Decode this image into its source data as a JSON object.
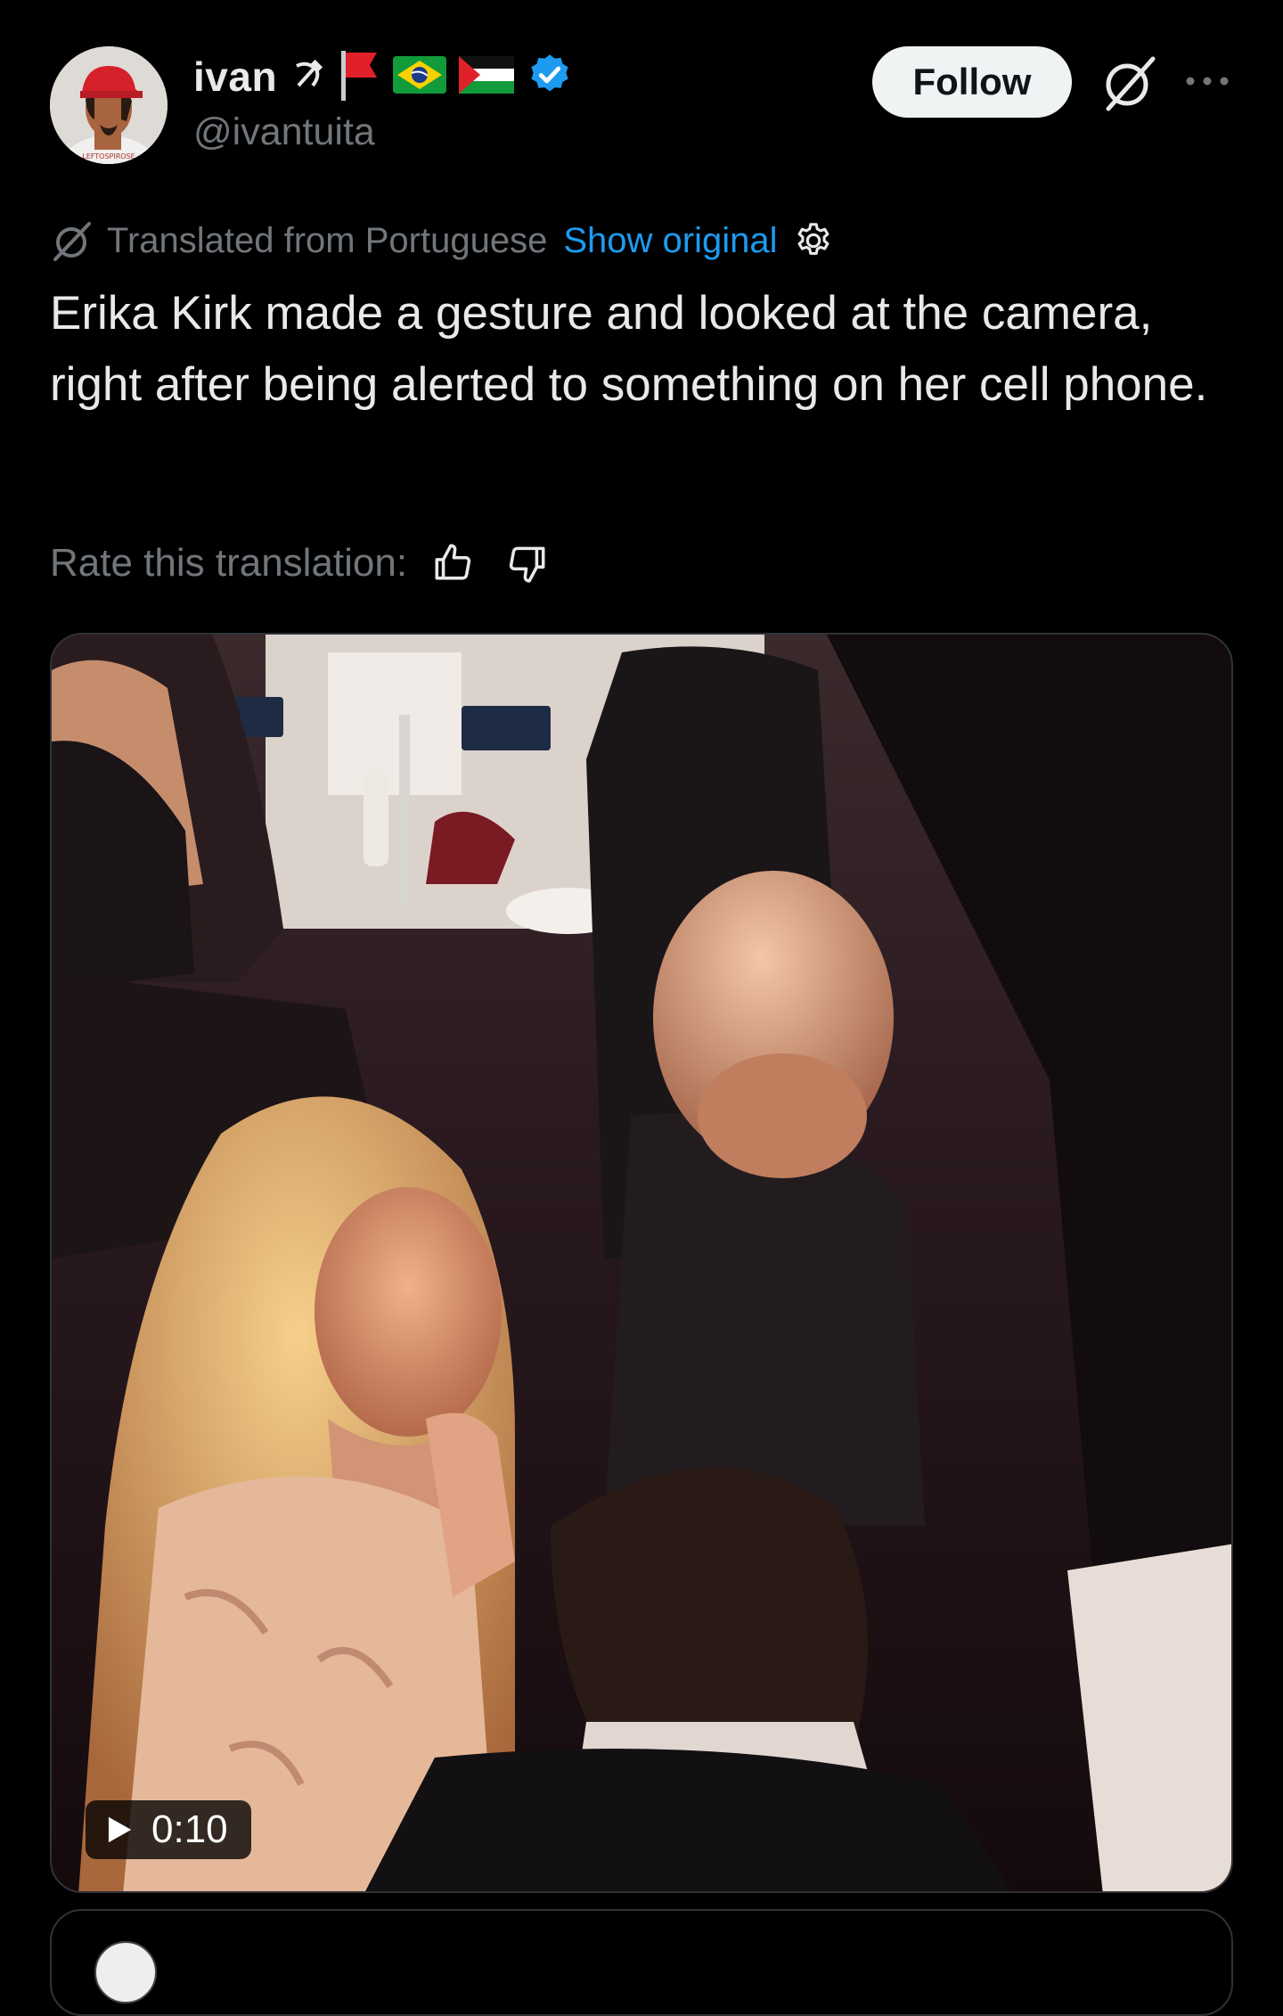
{
  "post": {
    "author": {
      "display_name": "ivan",
      "name_emojis": [
        "☭",
        "🚩",
        "🇧🇷",
        "🇵🇸"
      ],
      "handle": "@ivantuita",
      "verified": true,
      "avatar_cap_text": "LEFTOSPIROSE"
    },
    "follow_label": "Follow",
    "translation": {
      "note": "Translated from Portuguese",
      "show_original": "Show original",
      "rate_label": "Rate this translation:"
    },
    "text": "Erika Kirk made a gesture and looked at the camera, right after being alerted to something on her cell phone.",
    "media": {
      "type": "video",
      "duration": "0:10"
    }
  },
  "colors": {
    "background": "#000000",
    "text_primary": "#e7e9ea",
    "text_secondary": "#71767b",
    "link": "#1d9bf0",
    "verified": "#1d9bf0",
    "follow_bg": "#eff3f4"
  },
  "icons": [
    "grok-icon",
    "more-icon",
    "translate-icon",
    "settings-icon",
    "thumbs-up-icon",
    "thumbs-down-icon",
    "play-icon",
    "verified-badge-icon"
  ]
}
